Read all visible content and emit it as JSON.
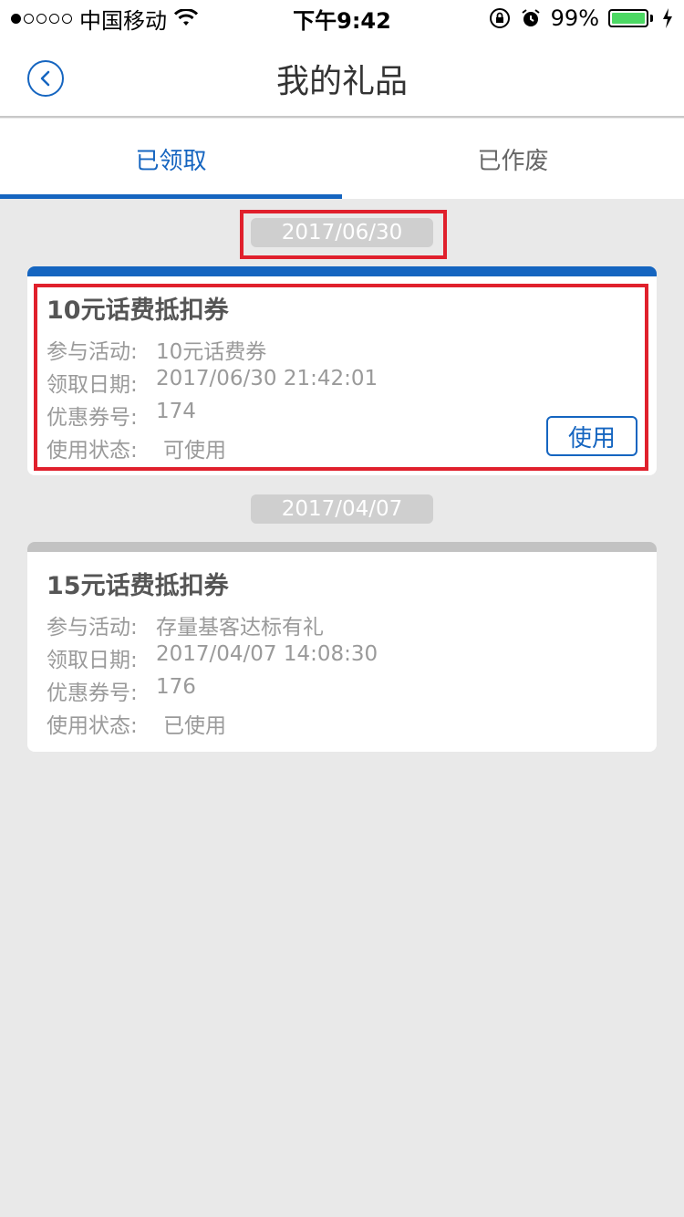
{
  "status_bar": {
    "carrier": "中国移动",
    "time": "下午9:42",
    "battery": "99%",
    "battery_level": 0.99
  },
  "nav": {
    "title": "我的礼品"
  },
  "tabs": [
    {
      "label": "已领取",
      "active": true
    },
    {
      "label": "已作废",
      "active": false
    }
  ],
  "gifts": [
    {
      "date": "2017/06/30",
      "title": "10元话费抵扣券",
      "activity_label": "参与活动:",
      "activity": "10元话费券",
      "date_label": "领取日期:",
      "received": "2017/06/30 21:42:01",
      "code_label": "优惠券号:",
      "code": "174",
      "status_label": "使用状态:",
      "status": "可使用",
      "action": "使用",
      "accent": "#1565c0"
    },
    {
      "date": "2017/04/07",
      "title": "15元话费抵扣券",
      "activity_label": "参与活动:",
      "activity": "存量基客达标有礼",
      "date_label": "领取日期:",
      "received": "2017/04/07 14:08:30",
      "code_label": "优惠券号:",
      "code": "176",
      "status_label": "使用状态:",
      "status": "已使用",
      "accent": "#c2c2c2"
    }
  ],
  "colors": {
    "brand": "#1565c0",
    "highlight": "#e0202c",
    "background": "#e9e9e9"
  }
}
